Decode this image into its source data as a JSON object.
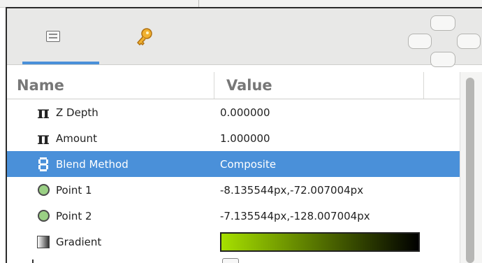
{
  "tabs": [
    {
      "icon": "panel-icon"
    },
    {
      "icon": "key-icon"
    }
  ],
  "header": {
    "name": "Name",
    "value": "Value"
  },
  "params": [
    {
      "icon": "pi-icon",
      "name": "Z Depth",
      "value": "0.000000"
    },
    {
      "icon": "pi-icon",
      "name": "Amount",
      "value": "1.000000"
    },
    {
      "icon": "blend-method-icon",
      "name": "Blend Method",
      "value": "Composite",
      "selected": true
    },
    {
      "icon": "point-icon",
      "name": "Point 1",
      "value": "-8.135544px,-72.007004px"
    },
    {
      "icon": "point-icon",
      "name": "Point 2",
      "value": "-7.135544px,-128.007004px"
    },
    {
      "icon": "gradient-icon",
      "name": "Gradient",
      "value_type": "gradient",
      "gradient_colors": [
        "#a6e000",
        "#000000"
      ]
    }
  ],
  "colors": {
    "selection": "#4a90d9",
    "point_fill": "#9ad084"
  }
}
